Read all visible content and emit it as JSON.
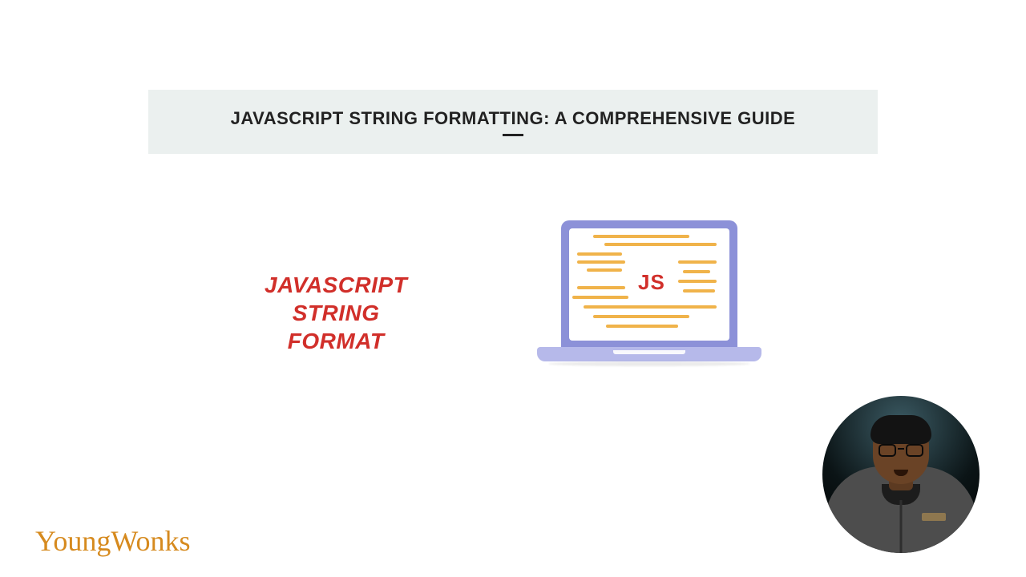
{
  "title": "JAVASCRIPT STRING FORMATTING: A COMPREHENSIVE GUIDE",
  "hero": {
    "line1": "JAVASCRIPT",
    "line2": "STRING",
    "line3": "FORMAT",
    "js_label": "JS"
  },
  "logo": "YoungWonks",
  "colors": {
    "title_band_bg": "#ebf0ef",
    "accent_red": "#d12f2a",
    "code_line": "#f0b34a",
    "laptop_outer": "#8c91d8",
    "laptop_base": "#b6b9ea",
    "logo_orange": "#d68a1e"
  }
}
